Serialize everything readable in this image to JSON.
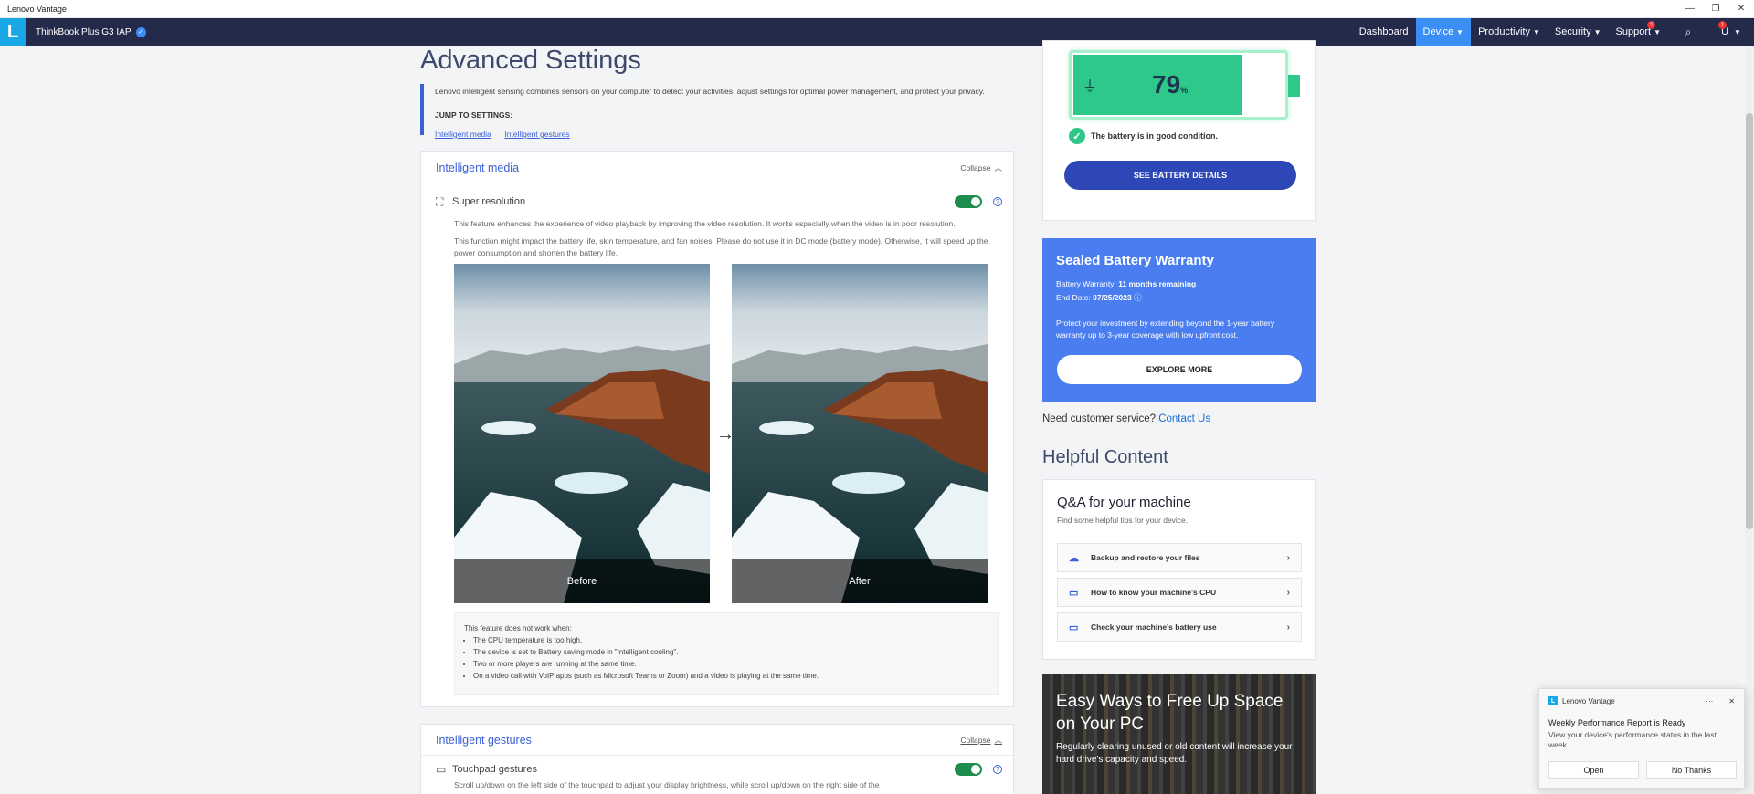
{
  "window": {
    "title": "Lenovo Vantage",
    "minimize_icon": "minimize-icon",
    "restore_icon": "restore-icon",
    "close_icon": "close-icon"
  },
  "nav": {
    "logo": "L",
    "device_name": "ThinkBook Plus G3 IAP",
    "items": [
      {
        "label": "Dashboard"
      },
      {
        "label": "Device",
        "active": true
      },
      {
        "label": "Productivity"
      },
      {
        "label": "Security"
      },
      {
        "label": "Support",
        "badge": "2"
      }
    ],
    "user_initial": "U",
    "user_badge": "1"
  },
  "page": {
    "title": "Advanced Settings",
    "intro": "Lenovo intelligent sensing combines sensors on your computer to detect your activities, adjust settings for optimal power management, and protect your privacy.",
    "jump_label": "JUMP TO SETTINGS:",
    "jump_links": [
      "Intelligent media",
      "Intelligent gestures"
    ]
  },
  "intelligent_media": {
    "heading": "Intelligent media",
    "collapse": "Collapse",
    "feature": "Super resolution",
    "toggle_on": true,
    "desc1": "This feature enhances the experience of video playback by improving the video resolution. It works especially when the video is in poor resolution.",
    "desc2": "This function might impact the battery life, skin temperature, and fan noises. Please do not use it in DC mode (battery mode). Otherwise, it will speed up the power consumption and shorten the battery life.",
    "before": "Before",
    "after": "After",
    "notes_title": "This feature does not work when:",
    "notes": [
      "The CPU temperature is too high.",
      "The device is set to Battery saving mode in \"Intelligent cooling\".",
      "Two or more players are running at the same time.",
      "On a video call with VoIP apps (such as Microsoft Teams or Zoom) and a video is playing at the same time."
    ]
  },
  "intelligent_gestures": {
    "heading": "Intelligent gestures",
    "collapse": "Collapse",
    "feature": "Touchpad gestures",
    "toggle_on": true,
    "desc": "Scroll up/down on the left side of the touchpad to adjust your display brightness, while scroll up/down on the right side of the"
  },
  "battery": {
    "percent": "79",
    "percent_unit": "%",
    "level": 0.79,
    "condition": "The battery is in good condition.",
    "details_button": "SEE BATTERY DETAILS"
  },
  "warranty": {
    "title": "Sealed Battery Warranty",
    "line1_label": "Battery Warranty: ",
    "line1_value": "11 months remaining",
    "line2_label": "End Date: ",
    "line2_value": "07/25/2023",
    "promo": "Protect your investment by extending beyond the 1-year battery warranty up to 3-year coverage with low upfront cost.",
    "button": "EXPLORE MORE"
  },
  "customer_service": {
    "text": "Need customer service? ",
    "link": "Contact Us"
  },
  "helpful": {
    "title": "Helpful Content",
    "qa_title": "Q&A for your machine",
    "qa_sub": "Find some helpful tips for your device.",
    "items": [
      {
        "label": "Backup and restore your files",
        "icon": "cloud-upload-icon"
      },
      {
        "label": "How to know your machine's CPU",
        "icon": "laptop-icon"
      },
      {
        "label": "Check your machine's battery use",
        "icon": "battery-icon"
      }
    ]
  },
  "promo": {
    "title": "Easy Ways to Free Up Space on Your PC",
    "desc": "Regularly clearing unused or old content will increase your hard drive's capacity and speed."
  },
  "toast": {
    "app": "Lenovo Vantage",
    "title": "Weekly Performance Report is Ready",
    "body": "View your device's performance status in the last week",
    "open": "Open",
    "dismiss": "No Thanks"
  },
  "colors": {
    "nav_bg": "#232a4a",
    "accent": "#3a8ef6",
    "link": "#3a5fd6",
    "toggle_on": "#1e8c4c",
    "battery": "#2ec98a",
    "warranty_bg": "#4a7ef0"
  }
}
